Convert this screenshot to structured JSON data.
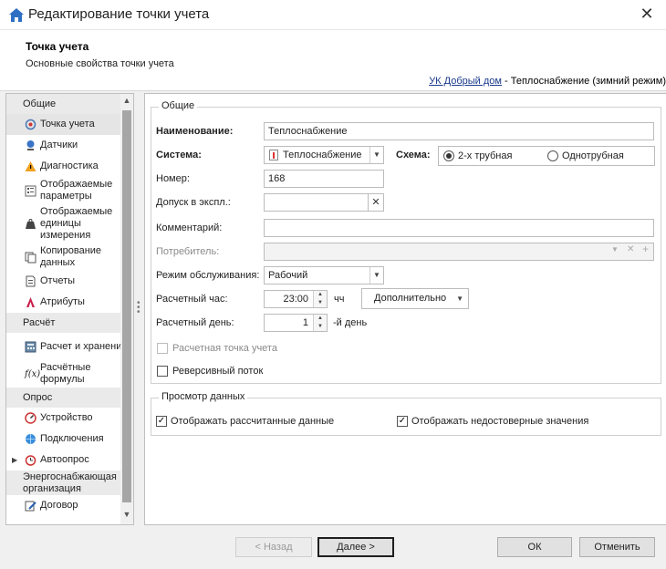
{
  "window": {
    "title": "Редактирование точки учета",
    "close_icon": "close-icon"
  },
  "header": {
    "title": "Точка учета",
    "subtitle": "Основные свойства точки учета",
    "crumb_link": "УК Добрый дом",
    "crumb_rest": " - Теплоснабжение (зимний режим)"
  },
  "nav": {
    "groups": {
      "general": "Общие",
      "calc": "Расчёт",
      "poll": "Опрос",
      "energy": "Энергоснабжающая организация"
    },
    "items": {
      "point": "Точка учета",
      "sensors": "Датчики",
      "diagnostics": "Диагностика",
      "params": "Отображаемые параметры",
      "units": "Отображаемые единицы измерения",
      "copy": "Копирование данных",
      "reports": "Отчеты",
      "attrs": "Атрибуты",
      "calc_storage": "Расчет и хранение",
      "formulas": "Расчётные формулы",
      "device": "Устройство",
      "connections": "Подключения",
      "autopoll": "Автоопрос",
      "contract": "Договор"
    },
    "selected": "Точка учета"
  },
  "form": {
    "section_general": "Общие",
    "name_label": "Наименование:",
    "name_value": "Теплоснабжение",
    "system_label": "Система:",
    "system_value": "Теплоснабжение",
    "scheme_label": "Схема:",
    "scheme_options": [
      "2-х трубная",
      "Однотрубная"
    ],
    "scheme_selected": "2-х трубная",
    "number_label": "Номер:",
    "number_value": "168",
    "admission_label": "Допуск в экспл.:",
    "admission_value": "",
    "comment_label": "Комментарий:",
    "comment_value": "",
    "consumer_label": "Потребитель:",
    "consumer_value": "",
    "service_label": "Режим обслуживания:",
    "service_value": "Рабочий",
    "calc_hour_label": "Расчетный час:",
    "calc_hour_value": "23:00",
    "calc_hour_unit": "чч",
    "extra_button": "Дополнительно",
    "calc_day_label": "Расчетный день:",
    "calc_day_value": "1",
    "calc_day_unit": "-й день",
    "calc_point_label": "Расчетная точка учета",
    "calc_point_checked": false,
    "reverse_label": "Реверсивный поток",
    "reverse_checked": false,
    "section_view": "Просмотр данных",
    "show_calc_label": "Отображать рассчитанные данные",
    "show_calc_checked": true,
    "show_unreliable_label": "Отображать недостоверные значения",
    "show_unreliable_checked": true
  },
  "footer": {
    "back": "< Назад",
    "next": "Далее >",
    "ok": "ОК",
    "cancel": "Отменить"
  }
}
